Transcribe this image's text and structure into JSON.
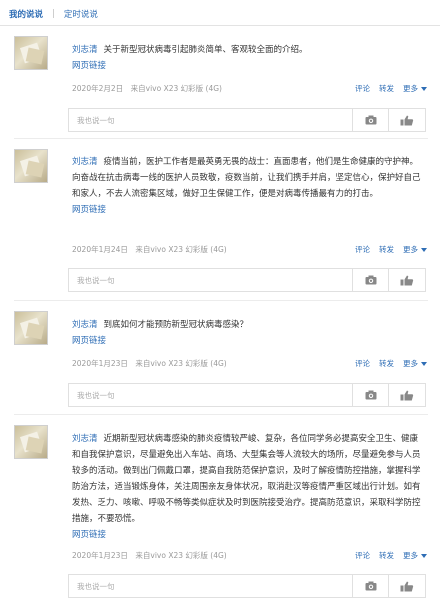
{
  "tabs": {
    "mine": "我的说说",
    "scheduled": "定时说说"
  },
  "placeholder": "我也说一句",
  "actions": {
    "comment": "评论",
    "forward": "转发",
    "more": "更多"
  },
  "posts": [
    {
      "author": "刘志清",
      "text": "关于新型冠状病毒引起肺炎简单、客观较全面的介绍。",
      "link": "网页链接",
      "meta": "2020年2月2日　来自vivo X23 幻彩版 (4G)"
    },
    {
      "author": "刘志清",
      "text": "疫情当前，医护工作者是最英勇无畏的战士：直面患者，他们是生命健康的守护神。向奋战在抗击病毒一线的医护人员致敬，疫数当前，让我们携手并肩，坚定信心，保护好自己和家人，不去人流密集区域，做好卫生保健工作，便是对病毒传播最有力的打击。",
      "link": "网页链接",
      "meta": "2020年1月24日　来自vivo X23 幻彩版 (4G)"
    },
    {
      "author": "刘志清",
      "text": "到底如何才能预防新型冠状病毒感染？",
      "link": "网页链接",
      "meta": "2020年1月23日　来自vivo X23 幻彩版 (4G)"
    },
    {
      "author": "刘志清",
      "text": "近期新型冠状病毒感染的肺炎疫情较严峻、复杂，各位同学务必提高安全卫生、健康和自我保护意识，尽量避免出入车站、商场、大型集会等人流较大的场所，尽量避免参与人员较多的活动。做到出门佩戴口罩，提高自我防范保护意识，及时了解疫情防控措施，掌握科学防治方法，适当锻炼身体，关注周围亲友身体状况，取消赴汉等疫情严重区域出行计划。如有发热、乏力、咳嗽、呼吸不畅等类似症状及时到医院接受治疗。提高防范意识，采取科学防控措施，不要恐慌。",
      "link": "网页链接",
      "meta": "2020年1月23日　来自vivo X23 幻彩版 (4G)"
    }
  ]
}
